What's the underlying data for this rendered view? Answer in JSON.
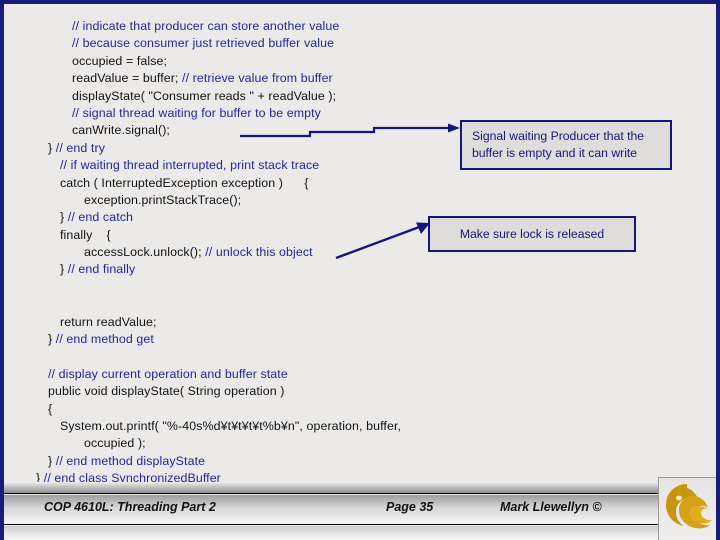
{
  "slide": {
    "background_color": "#eceae9",
    "border_color": "#1a1a7a",
    "comment_color": "#2323a8",
    "code_color": "#111111",
    "callout_border_color": "#15157e"
  },
  "code": {
    "lines": [
      {
        "indent": 3,
        "kind": "comment",
        "text": "// indicate that producer can store another value"
      },
      {
        "indent": 3,
        "kind": "comment",
        "text": "// because consumer just retrieved buffer value"
      },
      {
        "indent": 3,
        "kind": "code",
        "text": "occupied = false;"
      },
      {
        "indent": 3,
        "kind": "mixed",
        "code": "readValue = buffer; ",
        "comment": "// retrieve value from buffer"
      },
      {
        "indent": 3,
        "kind": "code",
        "text": "displayState( \"Consumer reads \" + readValue );"
      },
      {
        "indent": 3,
        "kind": "comment",
        "text": "// signal thread waiting for buffer to be empty"
      },
      {
        "indent": 3,
        "kind": "code",
        "text": "canWrite.signal();"
      },
      {
        "indent": 1,
        "kind": "mixed",
        "code": "} ",
        "comment": "// end try"
      },
      {
        "indent": 2,
        "kind": "comment",
        "text": "// if waiting thread interrupted, print stack trace"
      },
      {
        "indent": 2,
        "kind": "code",
        "text": "catch ( InterruptedException exception )      {"
      },
      {
        "indent": 4,
        "kind": "code",
        "text": "exception.printStackTrace();"
      },
      {
        "indent": 2,
        "kind": "mixed",
        "code": "} ",
        "comment": "// end catch"
      },
      {
        "indent": 2,
        "kind": "code",
        "text": "finally    {"
      },
      {
        "indent": 4,
        "kind": "mixed",
        "code": "accessLock.unlock(); ",
        "comment": "// unlock this object"
      },
      {
        "indent": 2,
        "kind": "mixed",
        "code": "} ",
        "comment": "// end finally"
      },
      {
        "indent": 0,
        "kind": "blank",
        "text": ""
      },
      {
        "indent": 0,
        "kind": "blank",
        "text": ""
      },
      {
        "indent": 2,
        "kind": "code",
        "text": "return readValue;"
      },
      {
        "indent": 1,
        "kind": "mixed",
        "code": "} ",
        "comment": "// end method get"
      },
      {
        "indent": 0,
        "kind": "blank",
        "text": ""
      },
      {
        "indent": 1,
        "kind": "comment",
        "text": "// display current operation and buffer state"
      },
      {
        "indent": 1,
        "kind": "code",
        "text": "public void displayState( String operation )"
      },
      {
        "indent": 1,
        "kind": "code",
        "text": "{"
      },
      {
        "indent": 2,
        "kind": "code",
        "text": "System.out.printf( \"%-40s%d¥t¥t¥t¥t%b¥n\", operation, buffer,"
      },
      {
        "indent": 4,
        "kind": "code",
        "text": "occupied );"
      },
      {
        "indent": 1,
        "kind": "mixed",
        "code": "} ",
        "comment": "// end method displayState"
      },
      {
        "indent": 0,
        "kind": "mixed",
        "code": "} ",
        "comment": "// end class SynchronizedBuffer"
      }
    ]
  },
  "callouts": [
    {
      "id": "signal",
      "text": "Signal waiting Producer that the buffer is empty and it can write"
    },
    {
      "id": "lock",
      "text": "Make sure lock is released"
    }
  ],
  "footer": {
    "course": "COP 4610L: Threading Part 2",
    "page": "Page 35",
    "author": "Mark Llewellyn ©"
  }
}
